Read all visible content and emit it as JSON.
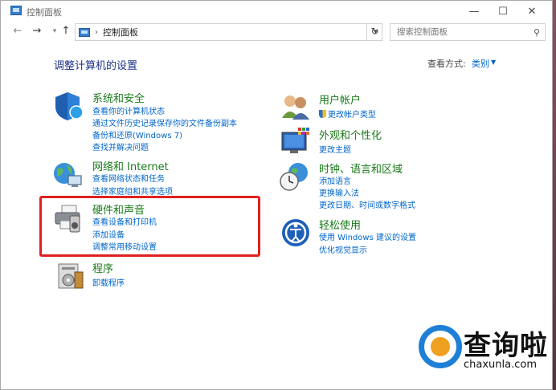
{
  "window": {
    "title": "控制面板"
  },
  "nav": {
    "back": "←",
    "forward": "→",
    "recent": "▾",
    "up": "↑",
    "address": "控制面板",
    "address_sep": "›",
    "refresh": "↻",
    "search_placeholder": "搜索控制面板"
  },
  "main": {
    "heading": "调整计算机的设置",
    "view_by_label": "查看方式:",
    "view_by_value": "类别"
  },
  "categories": {
    "system": {
      "title": "系统和安全",
      "links": [
        "查看你的计算机状态",
        "通过文件历史记录保存你的文件备份副本",
        "备份和还原(Windows 7)",
        "查找并解决问题"
      ]
    },
    "network": {
      "title": "网络和 Internet",
      "links": [
        "查看网络状态和任务",
        "选择家庭组和共享选项"
      ]
    },
    "hardware": {
      "title": "硬件和声音",
      "links": [
        "查看设备和打印机",
        "添加设备",
        "调整常用移动设置"
      ]
    },
    "programs": {
      "title": "程序",
      "links": [
        "卸载程序"
      ]
    },
    "users": {
      "title": "用户帐户",
      "links": [
        "更改帐户类型"
      ]
    },
    "appearance": {
      "title": "外观和个性化",
      "links": [
        "更改主题"
      ]
    },
    "clock": {
      "title": "时钟、语言和区域",
      "links": [
        "添加语言",
        "更换输入法",
        "更改日期、时间或数字格式"
      ]
    },
    "ease": {
      "title": "轻松使用",
      "links": [
        "使用 Windows 建议的设置",
        "优化视觉显示"
      ]
    }
  },
  "watermark": {
    "text": "查询啦",
    "url": "chaxunla.com"
  },
  "colors": {
    "link": "#0066cc",
    "category_title": "#1a7a1a",
    "heading": "#1e3287",
    "highlight": "#e02020"
  }
}
